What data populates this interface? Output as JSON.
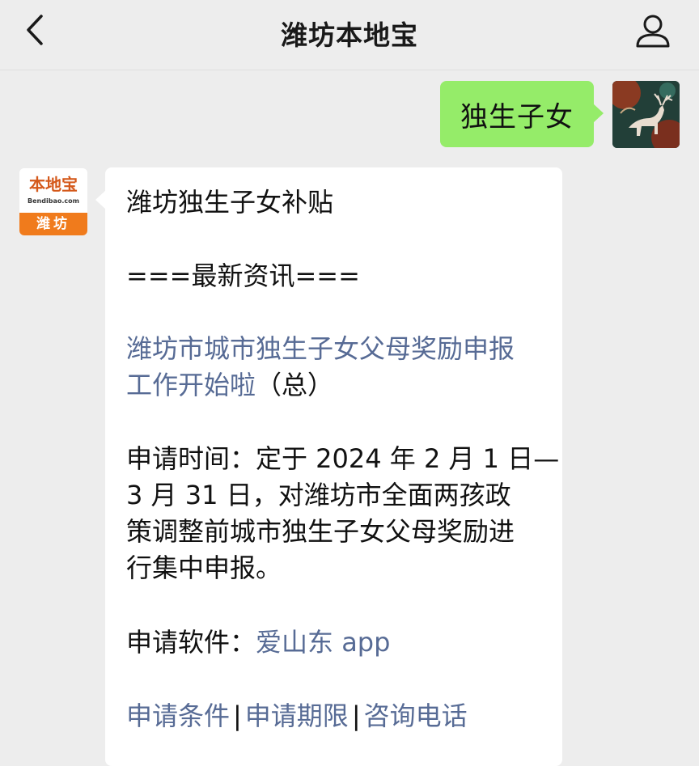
{
  "header": {
    "title": "潍坊本地宝",
    "back_icon": "chevron-left-icon",
    "profile_icon": "person-icon"
  },
  "sent_message": {
    "text": "独生子女"
  },
  "bot": {
    "logo_main": "本地宝",
    "logo_sub": "Bendibao.com",
    "logo_city": "潍坊"
  },
  "reply": {
    "title": "潍坊独生子女补贴",
    "news_header": "===最新资讯===",
    "article_link_line1": "潍坊市城市独生子女父母奖励申报",
    "article_link_line2": "工作开始啦",
    "article_suffix": "（总）",
    "time_lines": [
      "申请时间：定于 2024 年 2 月 1 日—",
      "3 月 31 日，对潍坊市全面两孩政",
      "策调整前城市独生子女父母奖励进",
      "行集中申报。"
    ],
    "software_label": "申请软件：",
    "software_link": "爱山东 app",
    "links": [
      "申请条件",
      "申请期限",
      "咨询电话"
    ],
    "separator": "|"
  },
  "colors": {
    "background": "#ededed",
    "sent_bubble": "#95ec69",
    "link": "#576b95",
    "logo_orange": "#f07b1c"
  }
}
